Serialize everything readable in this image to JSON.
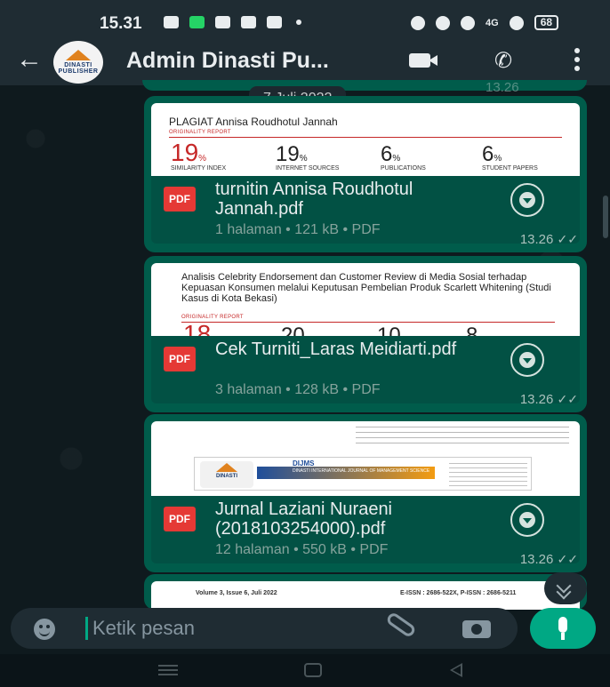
{
  "status_bar": {
    "time": "15.31",
    "signal_label": "4G",
    "battery": "68"
  },
  "header": {
    "back_icon": "arrow-left-icon",
    "avatar_text": "DINASTI PUBLISHER",
    "contact_name": "Admin Dinasti Pu...",
    "video_icon": "video-call-icon",
    "call_icon": "phone-icon",
    "menu_icon": "more-vert-icon"
  },
  "chat": {
    "prev_time": "13.26",
    "date_chip": "7 Juli 2022",
    "messages": [
      {
        "preview": {
          "title": "PLAGIAT Annisa Roudhotul Jannah",
          "report_label": "ORIGINALITY REPORT",
          "stats": [
            {
              "value": "19",
              "unit": "%",
              "label": "SIMILARITY INDEX"
            },
            {
              "value": "19",
              "unit": "%",
              "label": "INTERNET SOURCES"
            },
            {
              "value": "6",
              "unit": "%",
              "label": "PUBLICATIONS"
            },
            {
              "value": "6",
              "unit": "%",
              "label": "STUDENT PAPERS"
            }
          ]
        },
        "file_type": "PDF",
        "file_name": "turnitin Annisa Roudhotul Jannah.pdf",
        "meta": "1 halaman • 121 kB • PDF",
        "time": "13.26"
      },
      {
        "preview": {
          "text": "Analisis Celebrity Endorsement dan Customer Review di Media Sosial terhadap Kepuasan Konsumen melalui Keputusan Pembelian Produk Scarlett Whitening (Studi Kasus di Kota Bekasi)",
          "report_label": "ORIGINALITY REPORT",
          "stats": [
            {
              "value": "18",
              "unit": "%"
            },
            {
              "value": "20",
              "unit": "%"
            },
            {
              "value": "10",
              "unit": "%"
            },
            {
              "value": "8",
              "unit": "%"
            }
          ]
        },
        "file_type": "PDF",
        "file_name": "Cek Turniti_Laras Meidiarti.pdf",
        "meta": "3 halaman • 128 kB • PDF",
        "time": "13.26"
      },
      {
        "preview": {
          "logo_text": "DINASTI",
          "journal_short": "DIJMS",
          "journal_name": "DINASTI INTERNATIONAL JOURNAL OF MANAGEMENT SCIENCE"
        },
        "file_type": "PDF",
        "file_name": "Jurnal Laziani Nuraeni (2018103254000).pdf",
        "meta": "12 halaman • 550 kB • PDF",
        "time": "13.26"
      },
      {
        "preview": {
          "left_header": "Volume 3, Issue 6, Juli 2022",
          "right_header": "E-ISSN : 2686-522X, P-ISSN : 2686-5211"
        }
      }
    ]
  },
  "input": {
    "placeholder": "Ketik pesan",
    "emoji_icon": "emoji-icon",
    "attach_icon": "paperclip-icon",
    "camera_icon": "camera-icon",
    "mic_icon": "mic-icon"
  },
  "colors": {
    "bubble": "#005c4b",
    "accent": "#00a884",
    "header": "#1f2c33",
    "background": "#0b1418"
  }
}
